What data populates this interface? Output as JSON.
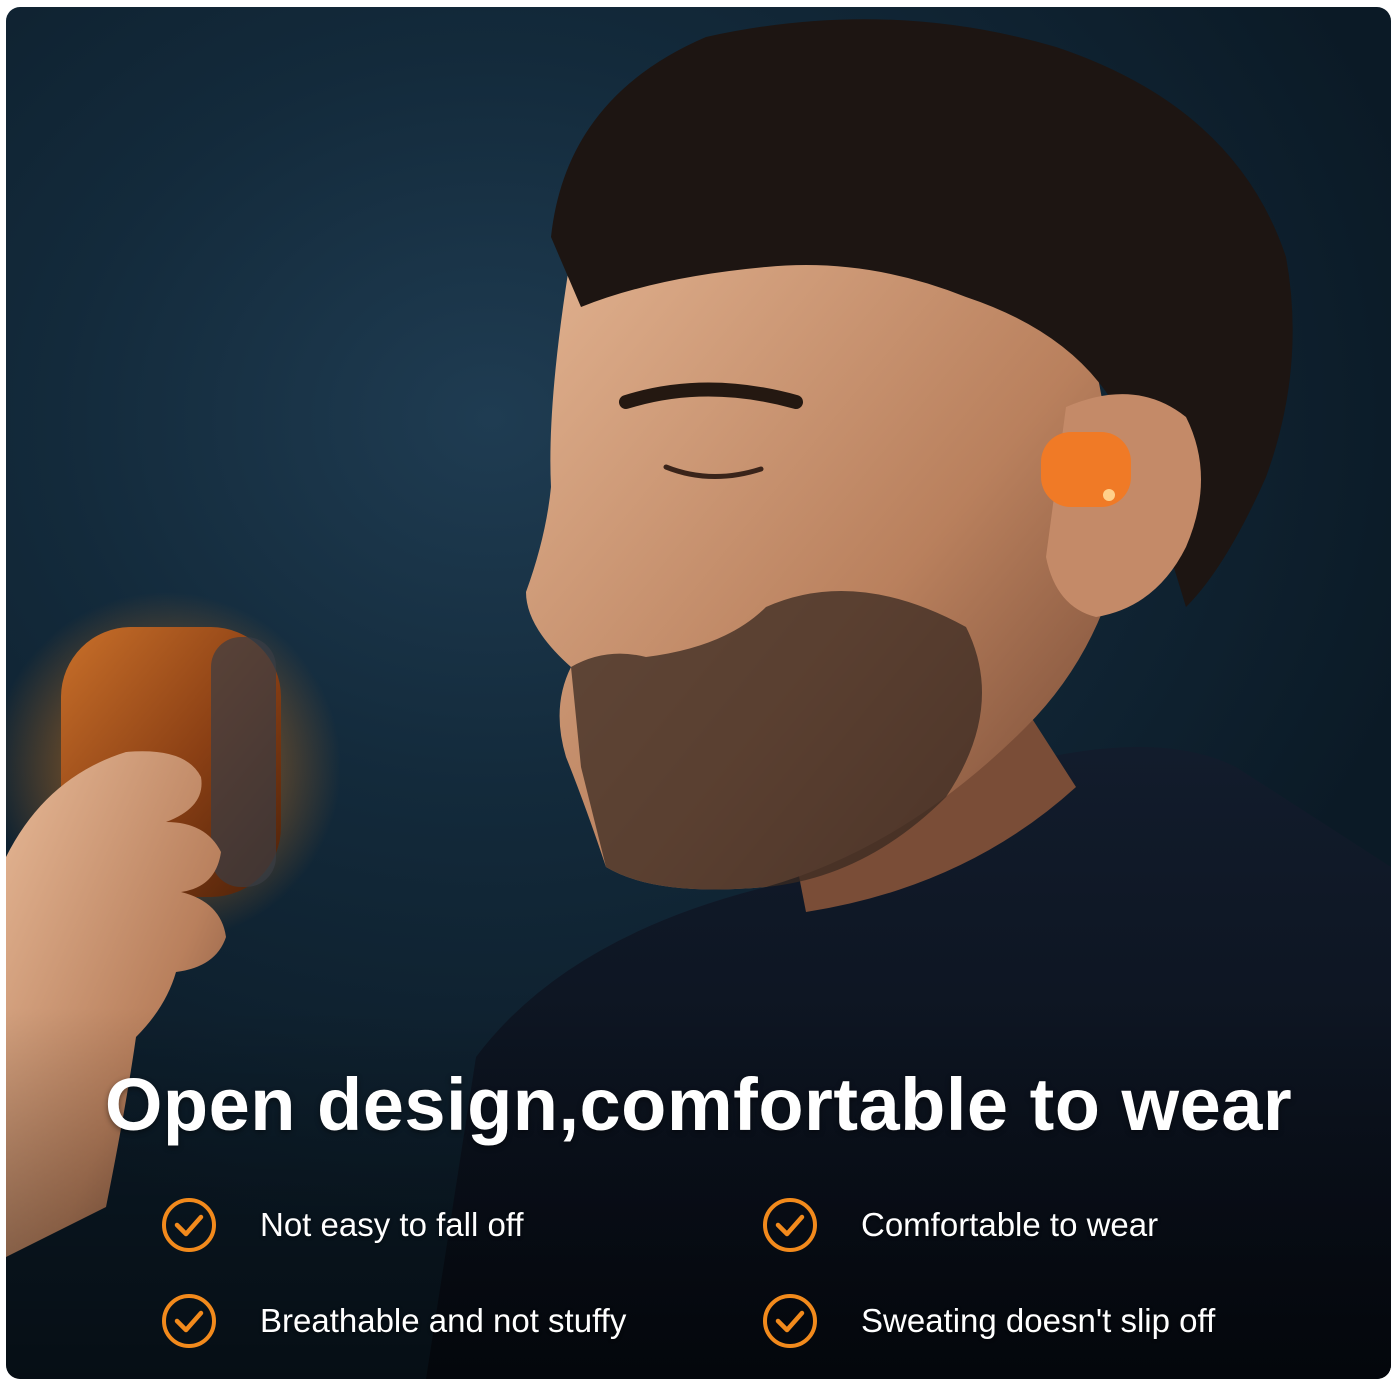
{
  "headline": "Open design,comfortable to wear",
  "features": [
    {
      "label": "Not easy to fall off",
      "icon": "check-circle-icon"
    },
    {
      "label": "Comfortable to wear",
      "icon": "check-circle-icon"
    },
    {
      "label": "Breathable and not stuffy",
      "icon": "check-circle-icon"
    },
    {
      "label": "Sweating doesn't slip off",
      "icon": "check-circle-icon"
    }
  ],
  "colors": {
    "accent": "#f28a1c",
    "background": "#132a3b",
    "text": "#ffffff"
  }
}
